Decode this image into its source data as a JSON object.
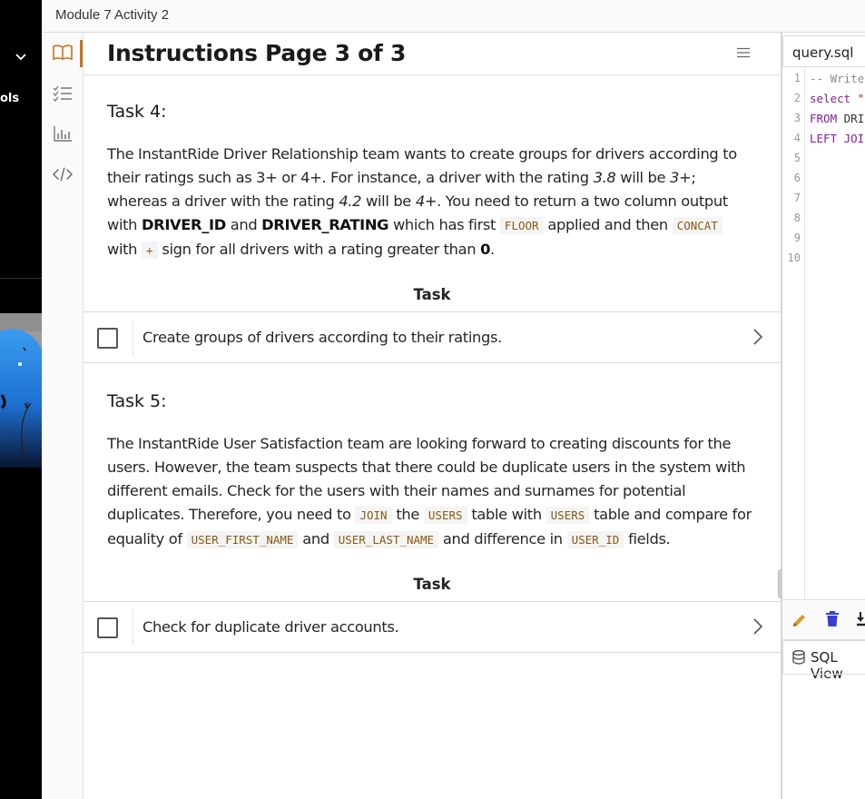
{
  "window": {
    "title": "Module 7 Activity 2"
  },
  "left_panel": {
    "label": "ols"
  },
  "instructions": {
    "heading": "Instructions Page 3 of 3",
    "task4": {
      "title": "Task 4:",
      "p1": "The InstantRide Driver Relationship team wants to create groups for drivers according to their ratings such as 3+ or 4+. For instance, a driver with the rating ",
      "v1": "3.8",
      "p2": " will be ",
      "v2": "3+",
      "p3": "; whereas a driver with the rating ",
      "v3": "4.2",
      "p4": " will be ",
      "v4": "4+",
      "p5": ". You need to return a two column output with ",
      "b1": "DRIVER_ID",
      "p6": " and ",
      "b2": "DRIVER_RATING",
      "p7": " which has first ",
      "c1": "FLOOR",
      "p8": " applied and then ",
      "c2": "CONCAT",
      "p9": " with ",
      "c3": "+",
      "p10": " sign for all drivers with a rating greater than ",
      "b3": "0",
      "p11": ".",
      "task_label": "Task",
      "item": "Create groups of drivers according to their ratings."
    },
    "task5": {
      "title": "Task 5:",
      "p1": "The InstantRide User Satisfaction team are looking forward to creating discounts for the users. However, the team suspects that there could be duplicate users in the system with different emails. Check for the users with their names and surnames for potential duplicates. Therefore, you need to ",
      "c1": "JOIN",
      "p2": " the ",
      "c2": "USERS",
      "p3": " table with ",
      "c3": "USERS",
      "p4": " table and compare for equality of ",
      "c4": "USER_FIRST_NAME",
      "p5": " and ",
      "c5": "USER_LAST_NAME",
      "p6": " and difference in ",
      "c6": "USER_ID",
      "p7": " fields.",
      "task_label": "Task",
      "item": "Check for duplicate driver accounts."
    }
  },
  "editor": {
    "tab": "query.sql",
    "line_numbers": [
      "1",
      "2",
      "3",
      "4",
      "5",
      "6",
      "7",
      "8",
      "9",
      "10"
    ],
    "lines": {
      "l1": "-- Write",
      "l2_kw": "select",
      "l2_str": "\"",
      "l3_kw": "FROM",
      "l3_rest": "DRI",
      "l4_kw": "LEFT JOI"
    },
    "bottom_tab": "SQL View"
  },
  "colors": {
    "accent": "#c9731b",
    "trash": "#3b3bd6",
    "pencil": "#d89a2a"
  }
}
